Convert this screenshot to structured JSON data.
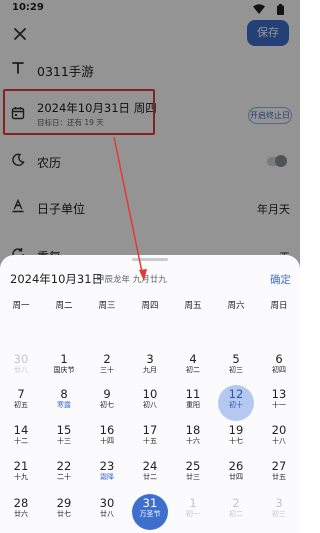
{
  "status_bar": {
    "time": "10:29"
  },
  "top_bar": {
    "save_label": "保存"
  },
  "form": {
    "title_value": "0311手游",
    "date_main": "2024年10月31日 周四",
    "date_sub": "目标日：还有 19 天",
    "end_button": "开启终止日",
    "lunar_label": "农历",
    "lunar_enabled": false,
    "unit_label": "日子单位",
    "unit_value": "年月天",
    "repeat_label": "重复",
    "repeat_value": "无"
  },
  "calendar": {
    "header_date": "2024年10月31日",
    "header_lunar": "甲辰龙年 九月廿九",
    "confirm_label": "确定",
    "weekdays": [
      "周一",
      "周二",
      "周三",
      "周四",
      "周五",
      "周六",
      "周日"
    ],
    "weeks": [
      [
        {
          "day": "30",
          "lunar": "廿八",
          "muted": true
        },
        {
          "day": "1",
          "lunar": "国庆节"
        },
        {
          "day": "2",
          "lunar": "三十"
        },
        {
          "day": "3",
          "lunar": "九月"
        },
        {
          "day": "4",
          "lunar": "初二"
        },
        {
          "day": "5",
          "lunar": "初三"
        },
        {
          "day": "6",
          "lunar": "初四"
        }
      ],
      [
        {
          "day": "7",
          "lunar": "初五"
        },
        {
          "day": "8",
          "lunar": "寒露",
          "holiday": true
        },
        {
          "day": "9",
          "lunar": "初七"
        },
        {
          "day": "10",
          "lunar": "初八"
        },
        {
          "day": "11",
          "lunar": "重阳"
        },
        {
          "day": "12",
          "lunar": "初十",
          "today": true
        },
        {
          "day": "13",
          "lunar": "十一"
        }
      ],
      [
        {
          "day": "14",
          "lunar": "十二"
        },
        {
          "day": "15",
          "lunar": "十三"
        },
        {
          "day": "16",
          "lunar": "十四"
        },
        {
          "day": "17",
          "lunar": "十五"
        },
        {
          "day": "18",
          "lunar": "十六"
        },
        {
          "day": "19",
          "lunar": "十七"
        },
        {
          "day": "20",
          "lunar": "十八"
        }
      ],
      [
        {
          "day": "21",
          "lunar": "十九"
        },
        {
          "day": "22",
          "lunar": "二十"
        },
        {
          "day": "23",
          "lunar": "霜降",
          "holiday": true
        },
        {
          "day": "24",
          "lunar": "廿二"
        },
        {
          "day": "25",
          "lunar": "廿三"
        },
        {
          "day": "26",
          "lunar": "廿四"
        },
        {
          "day": "27",
          "lunar": "廿五"
        }
      ],
      [
        {
          "day": "28",
          "lunar": "廿六"
        },
        {
          "day": "29",
          "lunar": "廿七"
        },
        {
          "day": "30",
          "lunar": "廿八"
        },
        {
          "day": "31",
          "lunar": "万圣节",
          "selected": true
        },
        {
          "day": "1",
          "lunar": "初一",
          "muted": true
        },
        {
          "day": "2",
          "lunar": "初二",
          "muted": true
        },
        {
          "day": "3",
          "lunar": "初三",
          "muted": true
        }
      ]
    ]
  },
  "colors": {
    "accent": "#3f6fce",
    "highlight_box": "#e53935",
    "today_fill": "#b5c8ef"
  }
}
